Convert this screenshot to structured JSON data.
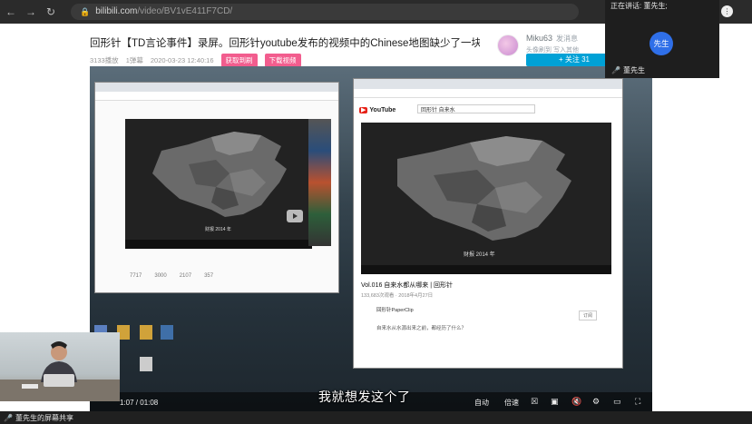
{
  "browser": {
    "url_host": "bilibili.com",
    "url_path": "/video/BV1vE411F7CD/"
  },
  "video_page": {
    "title": "回形针【TD言论事件】录屏。回形针youtube发布的视频中的Chinese地图缺少了一块版图。请更…",
    "views": "3133播放",
    "danmaku": "1弹幕",
    "date": "2020-03-23 12:40:16",
    "tags": [
      "获取到刷",
      "下载视频"
    ]
  },
  "uploader": {
    "name": "Miku63",
    "message": "发消息",
    "desc": "头像刷到 写入其他",
    "follow": "+ 关注 31"
  },
  "left_window": {
    "map_caption": "财报 2014 年",
    "stats": [
      "7717",
      "3000",
      "2107",
      "357"
    ]
  },
  "youtube_window": {
    "logo": "YouTube",
    "search": "回形针 自来水",
    "map_caption": "财报 2014 年",
    "video_title": "Vol.016 自来水都从哪来 | 回形针",
    "views": "133,683次观看 · 2018年4月27日",
    "channel": "回形针PaperClip",
    "subscribe": "订阅",
    "description": "自来水从水源出来之前，都经历了什么？"
  },
  "player": {
    "time": "1:07 / 01:08",
    "subtitle": "我就想发这个了",
    "auto_label": "自动",
    "speed_label": "倍速"
  },
  "meeting": {
    "speaking_label": "正在讲话: 董先生;",
    "speaker_avatar_text": "先生",
    "speaker_name": "董先生",
    "share_label": "董先生的屏幕共享"
  }
}
